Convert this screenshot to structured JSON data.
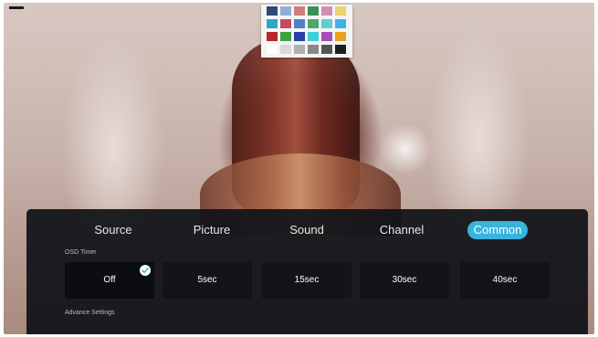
{
  "tabs": [
    {
      "label": "Source",
      "active": false
    },
    {
      "label": "Picture",
      "active": false
    },
    {
      "label": "Sound",
      "active": false
    },
    {
      "label": "Channel",
      "active": false
    },
    {
      "label": "Common",
      "active": true
    }
  ],
  "osd_timer": {
    "label": "OSD Timer",
    "selected": "Off",
    "options": [
      "Off",
      "5sec",
      "15sec",
      "30sec",
      "40sec"
    ]
  },
  "advance_settings": {
    "label": "Advance Settings"
  },
  "colors": {
    "accent": "#38b4dc",
    "panel_bg": "#101218",
    "text": "#ffffff",
    "swatches": [
      "#2c4a6e",
      "#8fb0d8",
      "#d27c7c",
      "#3c8f5a",
      "#d48fb0",
      "#e9d36a",
      "#2fa7c7",
      "#c24b5f",
      "#4f7fc7",
      "#4fa86a",
      "#5fcfcf",
      "#3fb2e6",
      "#b8242f",
      "#3f9f3f",
      "#2a3fa6",
      "#3fcfd8",
      "#a64fb8",
      "#e8a21f",
      "#ffffff",
      "#d8d8d8",
      "#b0b0b0",
      "#888888",
      "#555555",
      "#1e1e1e"
    ]
  },
  "icons": {
    "selected_indicator": "check-icon"
  }
}
